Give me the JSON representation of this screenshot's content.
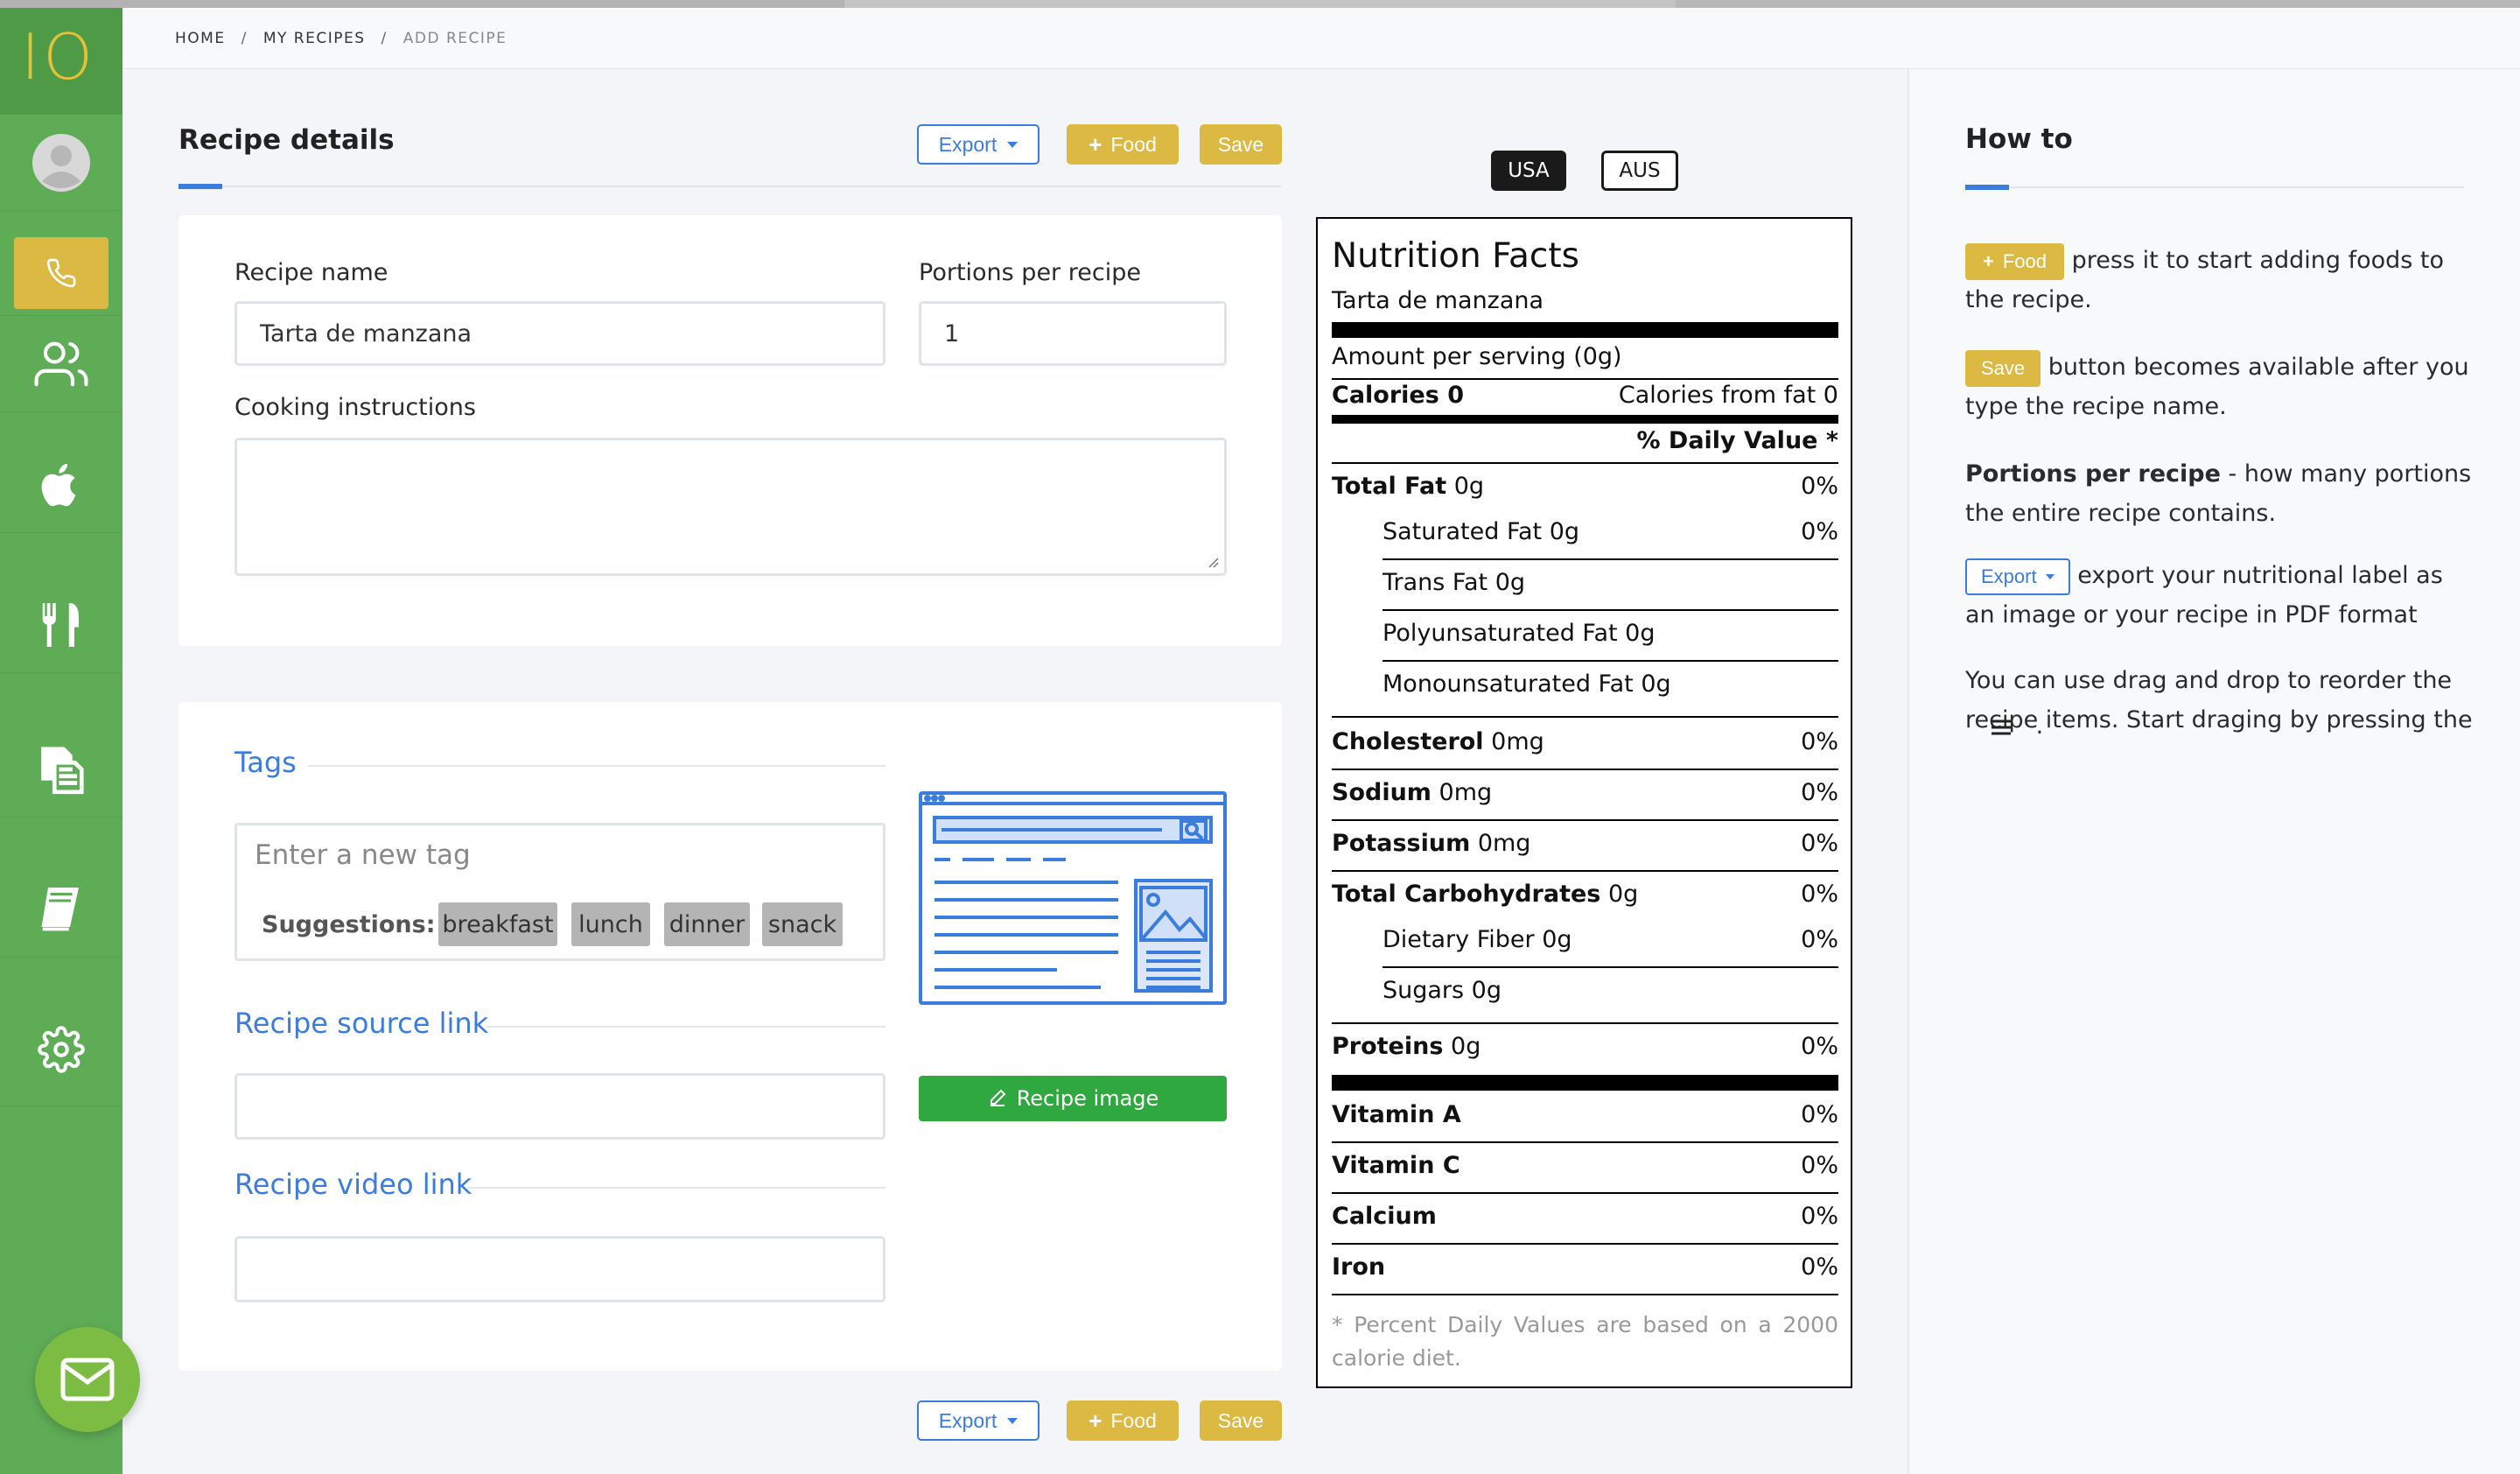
{
  "app": {
    "logo": "IO"
  },
  "breadcrumb": [
    "HOME",
    "MY RECIPES",
    "ADD RECIPE"
  ],
  "sidebar": {
    "items": [
      {
        "icon": "user-circle-icon"
      },
      {
        "icon": "phone-icon",
        "active": true
      },
      {
        "icon": "users-icon"
      },
      {
        "icon": "apple-icon"
      },
      {
        "icon": "fork-knife-icon"
      },
      {
        "icon": "documents-icon"
      },
      {
        "icon": "book-icon"
      },
      {
        "icon": "gear-icon"
      }
    ]
  },
  "recipe": {
    "section_title": "Recipe details",
    "export_label": "Export",
    "food_label": "Food",
    "save_label": "Save",
    "name_label": "Recipe name",
    "name_value": "Tarta de manzana",
    "portions_label": "Portions per recipe",
    "portions_value": "1",
    "instructions_label": "Cooking instructions",
    "instructions_value": ""
  },
  "tags": {
    "heading": "Tags",
    "placeholder": "Enter a new tag",
    "suggestions_label": "Suggestions:",
    "suggestions": [
      "breakfast",
      "lunch",
      "dinner",
      "snack"
    ]
  },
  "links": {
    "source_heading": "Recipe source link",
    "video_heading": "Recipe video link",
    "source_value": "",
    "video_value": ""
  },
  "image": {
    "button_label": "Recipe image"
  },
  "region": {
    "usa": "USA",
    "aus": "AUS",
    "selected": "USA"
  },
  "nutrition": {
    "title": "Nutrition Facts",
    "recipe_name": "Tarta de manzana",
    "amount_per_serving": "Amount per serving (0g)",
    "calories_label": "Calories 0",
    "calories_from_fat": "Calories from fat 0",
    "daily_value_header": "% Daily Value *",
    "rows": {
      "total_fat": {
        "label": "Total Fat",
        "value": "0g",
        "pct": "0%"
      },
      "saturated_fat": {
        "label": "Saturated Fat 0g",
        "pct": "0%"
      },
      "trans_fat": {
        "label": "Trans Fat 0g"
      },
      "poly_fat": {
        "label": "Polyunsaturated Fat 0g"
      },
      "mono_fat": {
        "label": "Monounsaturated Fat 0g"
      },
      "cholesterol": {
        "label": "Cholesterol",
        "value": "0mg",
        "pct": "0%"
      },
      "sodium": {
        "label": "Sodium",
        "value": "0mg",
        "pct": "0%"
      },
      "potassium": {
        "label": "Potassium",
        "value": "0mg",
        "pct": "0%"
      },
      "carbs": {
        "label": "Total Carbohydrates",
        "value": "0g",
        "pct": "0%"
      },
      "fiber": {
        "label": "Dietary Fiber 0g",
        "pct": "0%"
      },
      "sugars": {
        "label": "Sugars 0g"
      },
      "proteins": {
        "label": "Proteins",
        "value": "0g",
        "pct": "0%"
      },
      "vitamin_a": {
        "label": "Vitamin A",
        "pct": "0%"
      },
      "vitamin_c": {
        "label": "Vitamin C",
        "pct": "0%"
      },
      "calcium": {
        "label": "Calcium",
        "pct": "0%"
      },
      "iron": {
        "label": "Iron",
        "pct": "0%"
      }
    },
    "footnote": "* Percent Daily Values are based on a 2000 calorie diet."
  },
  "howto": {
    "title": "How to",
    "food_btn": "Food",
    "food_text": "press it to start adding foods to the recipe.",
    "save_btn": "Save",
    "save_text": "button becomes available after you type the recipe name.",
    "portions_bold": "Portions per recipe",
    "portions_text": "- how many portions the entire recipe contains.",
    "export_btn": "Export",
    "export_text": "export your nutritional label as an image or your recipe in PDF format",
    "drag_text": "You can use drag and drop to reorder the recipe items. Start draging by pressing the",
    "drag_end": "."
  }
}
